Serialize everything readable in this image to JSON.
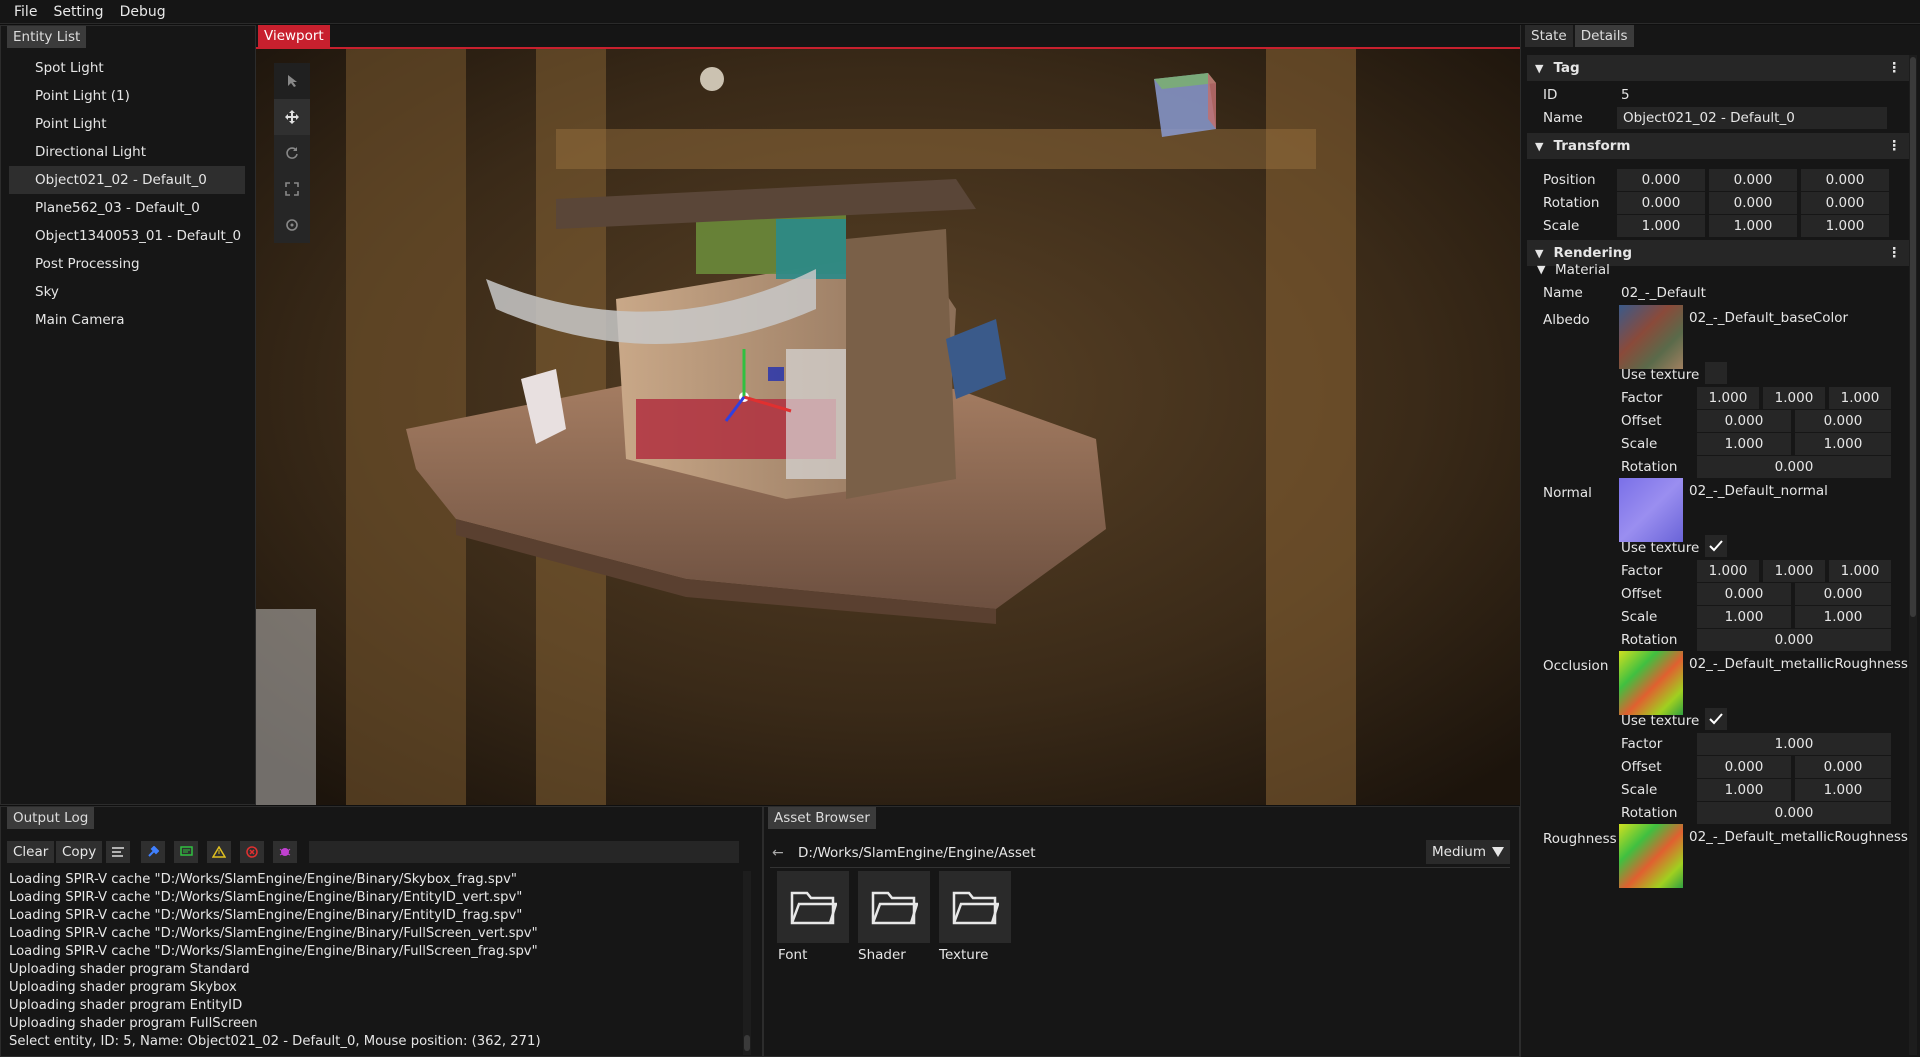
{
  "menu": [
    "File",
    "Setting",
    "Debug"
  ],
  "entity_panel": {
    "tab": "Entity List",
    "items": [
      "Spot Light",
      "Point Light (1)",
      "Point Light",
      "Directional Light",
      "Object021_02 - Default_0",
      "Plane562_03 - Default_0",
      "Object1340053_01 - Default_0",
      "Post Processing",
      "Sky",
      "Main Camera"
    ],
    "selected": "Object021_02 - Default_0"
  },
  "viewport": {
    "tab": "Viewport",
    "tools": [
      "cursor-icon",
      "move-icon",
      "rotate-icon",
      "scale-icon",
      "universal-icon"
    ]
  },
  "details_panel": {
    "tabs": [
      "State",
      "Details"
    ],
    "active_tab": "Details",
    "tag": {
      "header": "Tag",
      "id_label": "ID",
      "id_value": "5",
      "name_label": "Name",
      "name_value": "Object021_02 - Default_0"
    },
    "transform": {
      "header": "Transform",
      "position_label": "Position",
      "position": [
        "0.000",
        "0.000",
        "0.000"
      ],
      "rotation_label": "Rotation",
      "rotation": [
        "0.000",
        "0.000",
        "0.000"
      ],
      "scale_label": "Scale",
      "scale": [
        "1.000",
        "1.000",
        "1.000"
      ]
    },
    "rendering": {
      "header": "Rendering",
      "material_header": "Material",
      "name_label": "Name",
      "name_value": "02_-_Default",
      "albedo": {
        "label": "Albedo",
        "texture": "02_-_Default_baseColor",
        "use_texture_label": "Use texture",
        "use_texture": false,
        "factor_label": "Factor",
        "factor": [
          "1.000",
          "1.000",
          "1.000"
        ],
        "offset_label": "Offset",
        "offset": [
          "0.000",
          "0.000"
        ],
        "scale_label": "Scale",
        "scale": [
          "1.000",
          "1.000"
        ],
        "rotation_label": "Rotation",
        "rotation": "0.000"
      },
      "normal": {
        "label": "Normal",
        "texture": "02_-_Default_normal",
        "use_texture_label": "Use texture",
        "use_texture": true,
        "factor_label": "Factor",
        "factor": [
          "1.000",
          "1.000",
          "1.000"
        ],
        "offset_label": "Offset",
        "offset": [
          "0.000",
          "0.000"
        ],
        "scale_label": "Scale",
        "scale": [
          "1.000",
          "1.000"
        ],
        "rotation_label": "Rotation",
        "rotation": "0.000"
      },
      "occlusion": {
        "label": "Occlusion",
        "texture": "02_-_Default_metallicRoughness",
        "use_texture_label": "Use texture",
        "use_texture": true,
        "factor_label": "Factor",
        "factor": "1.000",
        "offset_label": "Offset",
        "offset": [
          "0.000",
          "0.000"
        ],
        "scale_label": "Scale",
        "scale": [
          "1.000",
          "1.000"
        ],
        "rotation_label": "Rotation",
        "rotation": "0.000"
      },
      "roughness": {
        "label": "Roughness",
        "texture": "02_-_Default_metallicRoughness"
      }
    }
  },
  "output_log": {
    "tab": "Output Log",
    "clear_label": "Clear",
    "copy_label": "Copy",
    "filter_value": "",
    "lines": [
      "Loading SPIR-V cache \"D:/Works/SlamEngine/Engine/Binary/Skybox_frag.spv\"",
      "Loading SPIR-V cache \"D:/Works/SlamEngine/Engine/Binary/EntityID_vert.spv\"",
      "Loading SPIR-V cache \"D:/Works/SlamEngine/Engine/Binary/EntityID_frag.spv\"",
      "Loading SPIR-V cache \"D:/Works/SlamEngine/Engine/Binary/FullScreen_vert.spv\"",
      "Loading SPIR-V cache \"D:/Works/SlamEngine/Engine/Binary/FullScreen_frag.spv\"",
      "Uploading shader program Standard",
      "Uploading shader program Skybox",
      "Uploading shader program EntityID",
      "Uploading shader program FullScreen",
      "Select entity, ID: 5, Name: Object021_02 - Default_0, Mouse position: (362, 271)"
    ]
  },
  "asset_browser": {
    "tab": "Asset Browser",
    "path": "D:/Works/SlamEngine/Engine/Asset",
    "size_option": "Medium",
    "folders": [
      "Font",
      "Shader",
      "Texture"
    ]
  }
}
